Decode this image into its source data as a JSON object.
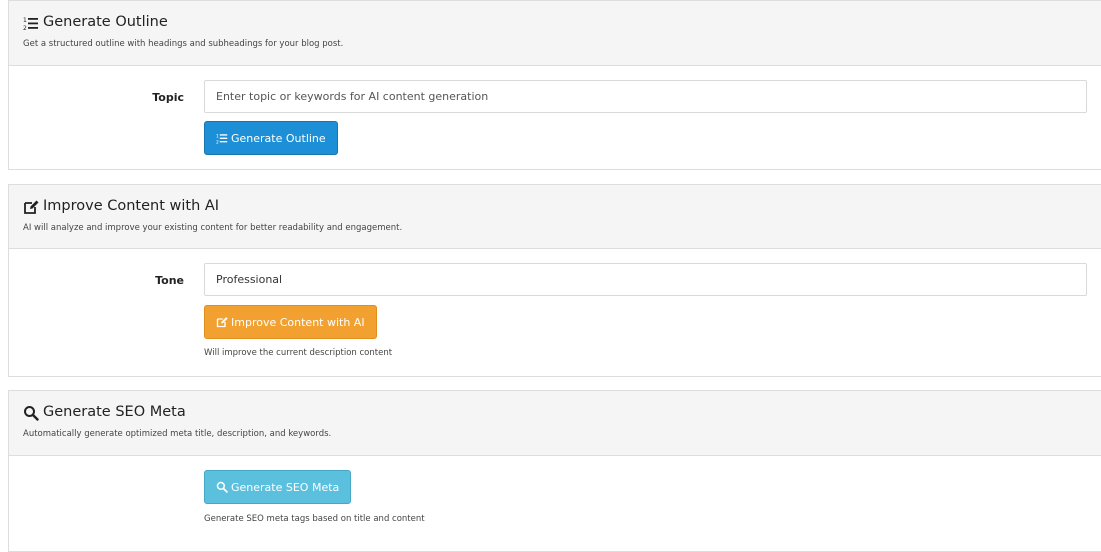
{
  "outline": {
    "title": "Generate Outline",
    "subtitle": "Get a structured outline with headings and subheadings for your blog post.",
    "icon": "list-ordered-icon",
    "topic_label": "Topic",
    "topic_placeholder": "Enter topic or keywords for AI content generation",
    "topic_value": "",
    "button_label": "Generate Outline",
    "button_color": "#1d8fd6"
  },
  "improve": {
    "title": "Improve Content with AI",
    "subtitle": "AI will analyze and improve your existing content for better readability and engagement.",
    "icon": "edit-icon",
    "tone_label": "Tone",
    "tone_value": "Professional",
    "button_label": "Improve Content with AI",
    "button_color": "#f2a130",
    "help_text": "Will improve the current description content"
  },
  "seo": {
    "title": "Generate SEO Meta",
    "subtitle": "Automatically generate optimized meta title, description, and keywords.",
    "icon": "search-icon",
    "button_label": "Generate SEO Meta",
    "button_color": "#5bc0de",
    "help_text": "Generate SEO meta tags based on title and content"
  }
}
